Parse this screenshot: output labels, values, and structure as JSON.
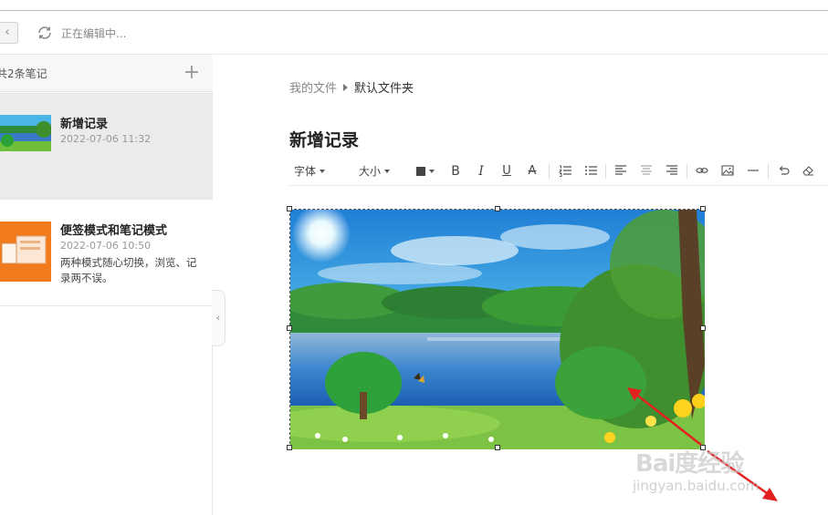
{
  "topbar": {
    "back_label": "‹",
    "status": "正在编辑中..."
  },
  "sidebar": {
    "count_label": "共2条笔记",
    "add_label": "+",
    "notes": [
      {
        "title": "新增记录",
        "date": "2022-07-06  11:32",
        "snippet": ""
      },
      {
        "title": "便签模式和笔记模式",
        "date": "2022-07-06  10:50",
        "snippet": "两种模式随心切换，浏览、记录两不误。"
      }
    ],
    "collapse_label": "‹"
  },
  "editor": {
    "breadcrumb": {
      "root": "我的文件",
      "current": "默认文件夹"
    },
    "title": "新增记录",
    "toolbar": {
      "font_label": "字体",
      "size_label": "大小",
      "bold": "B",
      "italic": "I",
      "underline": "U",
      "strike": "A"
    }
  },
  "watermark": {
    "main": "Bai度经验",
    "sub": "jingyan.baidu.com"
  },
  "colors": {
    "annotation_arrow": "#e32121",
    "selected_note_bg": "#ebebeb"
  },
  "icons": [
    "back-chevron-icon",
    "sync-icon",
    "plus-icon",
    "color-swatch-icon",
    "ordered-list-icon",
    "bullet-list-icon",
    "align-left-icon",
    "align-center-icon",
    "align-right-icon",
    "link-icon",
    "image-icon",
    "horizontal-rule-icon",
    "undo-icon",
    "eraser-icon"
  ]
}
